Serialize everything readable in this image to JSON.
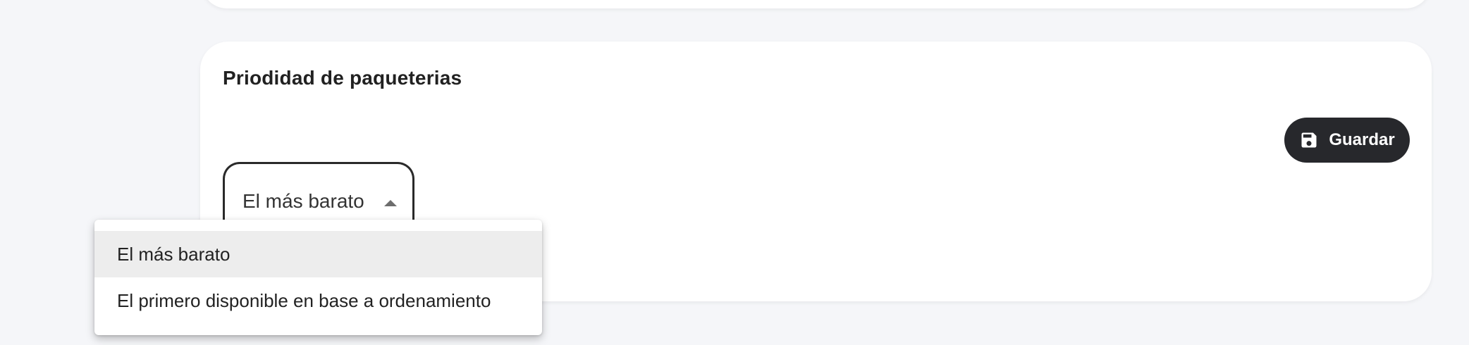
{
  "section": {
    "title": "Priodidad de paqueterias",
    "save_label": "Guardar"
  },
  "select": {
    "value": "El más barato",
    "options": [
      {
        "label": "El más barato",
        "selected": true
      },
      {
        "label": "El primero disponible en base a ordenamiento",
        "selected": false
      }
    ]
  },
  "icons": {
    "save": "floppy-disk-icon",
    "caret": "caret-up-icon"
  },
  "colors": {
    "page_background": "#f5f6f9",
    "button_background": "#27282c",
    "selected_option_background": "#ededed"
  }
}
